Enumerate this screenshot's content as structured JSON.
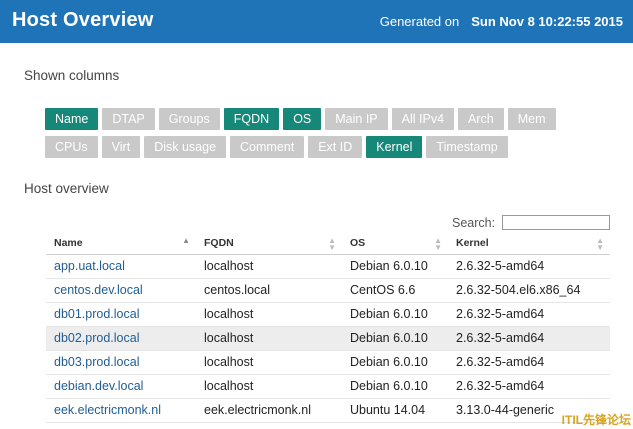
{
  "header": {
    "title": "Host Overview",
    "generated_label": "Generated on",
    "generated_date": "Sun Nov 8 10:22:55 2015",
    "bg_color": "#1f74b8"
  },
  "shown_columns": {
    "title": "Shown columns",
    "active_color": "#16887a",
    "inactive_color": "#c9c9c9",
    "row1": [
      {
        "label": "Name",
        "active": true
      },
      {
        "label": "DTAP",
        "active": false
      },
      {
        "label": "Groups",
        "active": false
      },
      {
        "label": "FQDN",
        "active": true
      },
      {
        "label": "OS",
        "active": true
      },
      {
        "label": "Main IP",
        "active": false
      },
      {
        "label": "All IPv4",
        "active": false
      },
      {
        "label": "Arch",
        "active": false
      },
      {
        "label": "Mem",
        "active": false
      }
    ],
    "row2": [
      {
        "label": "CPUs",
        "active": false
      },
      {
        "label": "Virt",
        "active": false
      },
      {
        "label": "Disk usage",
        "active": false
      },
      {
        "label": "Comment",
        "active": false
      },
      {
        "label": "Ext ID",
        "active": false
      },
      {
        "label": "Kernel",
        "active": true
      },
      {
        "label": "Timestamp",
        "active": false
      }
    ]
  },
  "host_overview": {
    "title": "Host overview",
    "search_label": "Search:",
    "search_value": "",
    "columns": [
      "Name",
      "FQDN",
      "OS",
      "Kernel"
    ],
    "rows": [
      {
        "name": "app.uat.local",
        "fqdn": "localhost",
        "os": "Debian 6.0.10",
        "kernel": "2.6.32-5-amd64",
        "highlight": false
      },
      {
        "name": "centos.dev.local",
        "fqdn": "centos.local",
        "os": "CentOS 6.6",
        "kernel": "2.6.32-504.el6.x86_64",
        "highlight": false
      },
      {
        "name": "db01.prod.local",
        "fqdn": "localhost",
        "os": "Debian 6.0.10",
        "kernel": "2.6.32-5-amd64",
        "highlight": false
      },
      {
        "name": "db02.prod.local",
        "fqdn": "localhost",
        "os": "Debian 6.0.10",
        "kernel": "2.6.32-5-amd64",
        "highlight": true
      },
      {
        "name": "db03.prod.local",
        "fqdn": "localhost",
        "os": "Debian 6.0.10",
        "kernel": "2.6.32-5-amd64",
        "highlight": false
      },
      {
        "name": "debian.dev.local",
        "fqdn": "localhost",
        "os": "Debian 6.0.10",
        "kernel": "2.6.32-5-amd64",
        "highlight": false
      },
      {
        "name": "eek.electricmonk.nl",
        "fqdn": "eek.electricmonk.nl",
        "os": "Ubuntu 14.04",
        "kernel": "3.13.0-44-generic",
        "highlight": false
      }
    ]
  },
  "watermark": "ITIL先锋论坛"
}
